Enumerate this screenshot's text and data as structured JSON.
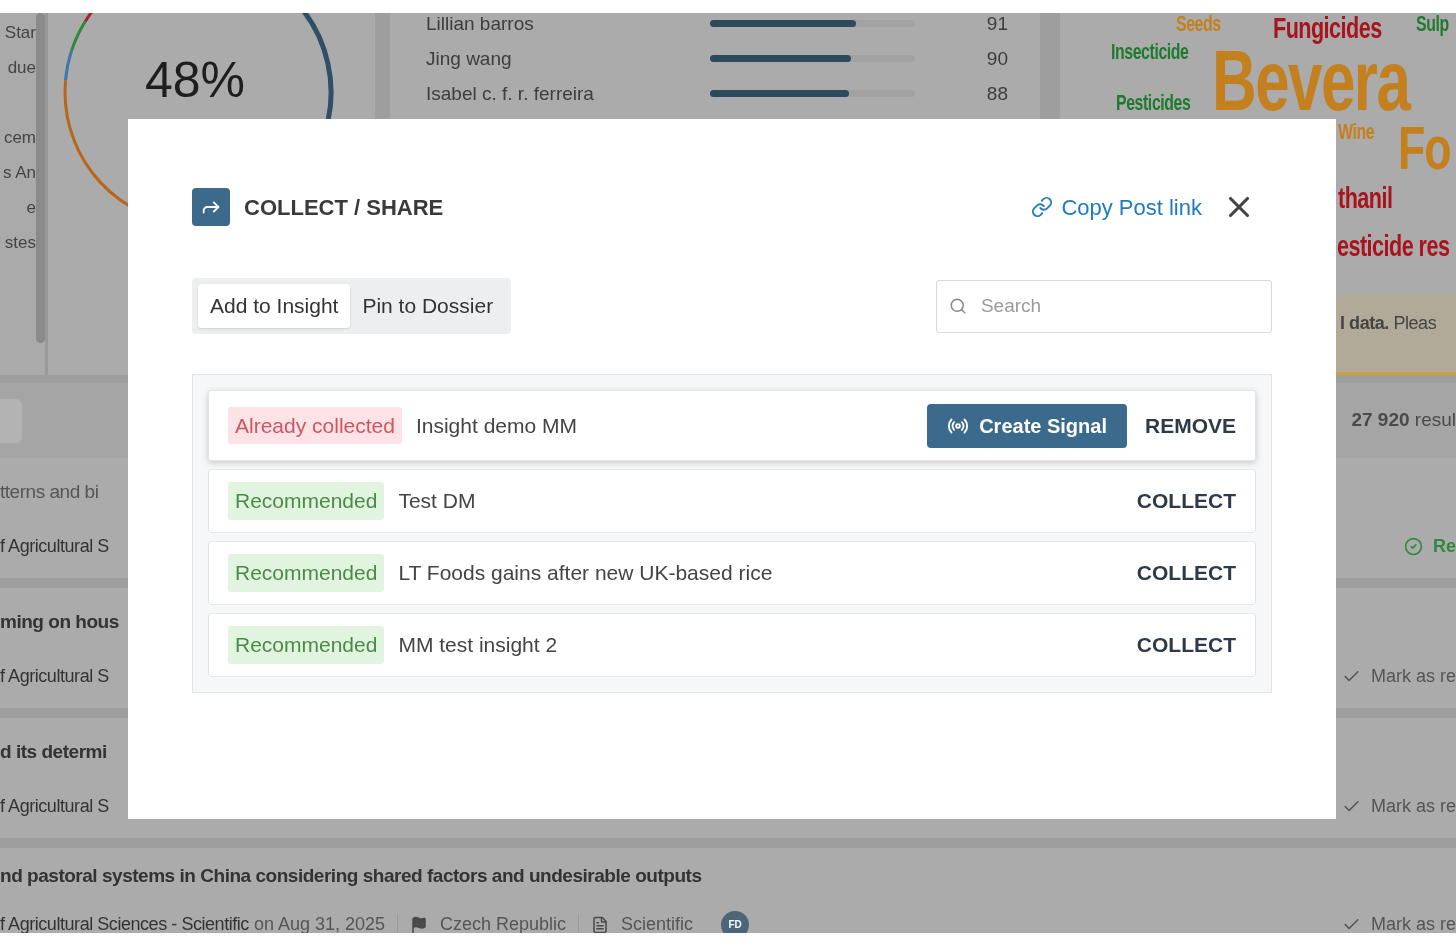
{
  "sidebar_fragments": [
    "Star",
    "due",
    "cem",
    "s An",
    "e",
    "stes"
  ],
  "gauge": {
    "value": "48%"
  },
  "authors": [
    {
      "name": "Lillian barros",
      "level": 0.71,
      "score": "91"
    },
    {
      "name": "Jing wang",
      "level": 0.69,
      "score": "90"
    },
    {
      "name": "Isabel c. f. r. ferreira",
      "level": 0.68,
      "score": "88"
    }
  ],
  "word_cloud": [
    {
      "text": "Seeds",
      "color": "#c47f1e",
      "kind": "small"
    },
    {
      "text": "Fungicides",
      "color": "#a8141e",
      "kind": "medium"
    },
    {
      "text": "Sulp",
      "color": "#1f7a2e",
      "kind": "small"
    },
    {
      "text": "Insecticide",
      "color": "#1f7a2e",
      "kind": "small"
    },
    {
      "text": "Pesticides",
      "color": "#1f7a2e",
      "kind": "small"
    },
    {
      "text": "Bevera",
      "color": "#c47f1e",
      "kind": "huge"
    },
    {
      "text": "Wine",
      "color": "#c47f1e",
      "kind": "small"
    },
    {
      "text": "Fo",
      "color": "#c47f1e",
      "kind": "large"
    },
    {
      "text": "thanil",
      "color": "#a8141e",
      "kind": "medium"
    },
    {
      "text": "esticide res",
      "color": "#a8141e",
      "kind": "medium"
    }
  ],
  "notice": "**l data.** Pleas",
  "results_count": "**27 920** resul",
  "results": [
    {
      "title": "tterns and bi",
      "source": "f Agricultural S",
      "read": true,
      "status": "Re"
    },
    {
      "title": "ming on hous",
      "source": "f Agricultural S",
      "read": false,
      "status": "Mark as re"
    },
    {
      "title": "d its determi",
      "source": "f Agricultural S",
      "read": false,
      "status": "Mark as re"
    },
    {
      "title": "nd pastoral systems in China considering shared factors and undesirable outputs",
      "source": "f Agricultural Sciences - Scientific",
      "date": "on Aug 31, 2025",
      "country": "Czech Republic",
      "doc_type": "Scientific",
      "avatar": "FD",
      "read": false,
      "status": "Mark as re"
    }
  ],
  "modal": {
    "title": "COLLECT / SHARE",
    "copy_link": "Copy Post link",
    "tabs": [
      {
        "label": "Add to Insight",
        "selected": true
      },
      {
        "label": "Pin to Dossier",
        "selected": false
      }
    ],
    "search": {
      "placeholder": "Search"
    },
    "insights": [
      {
        "badge": {
          "kind": "collected",
          "text": "Already collected"
        },
        "name": "Insight demo MM",
        "signal_button": "Create Signal",
        "action": "REMOVE",
        "highlighted": true
      },
      {
        "badge": {
          "kind": "recommended",
          "text": "Recommended"
        },
        "name": "Test DM",
        "action": "COLLECT",
        "highlighted": false
      },
      {
        "badge": {
          "kind": "recommended",
          "text": "Recommended"
        },
        "name": "LT Foods gains after new UK-based rice",
        "action": "COLLECT",
        "highlighted": false
      },
      {
        "badge": {
          "kind": "recommended",
          "text": "Recommended"
        },
        "name": "MM test insight 2",
        "action": "COLLECT",
        "highlighted": false
      }
    ]
  }
}
